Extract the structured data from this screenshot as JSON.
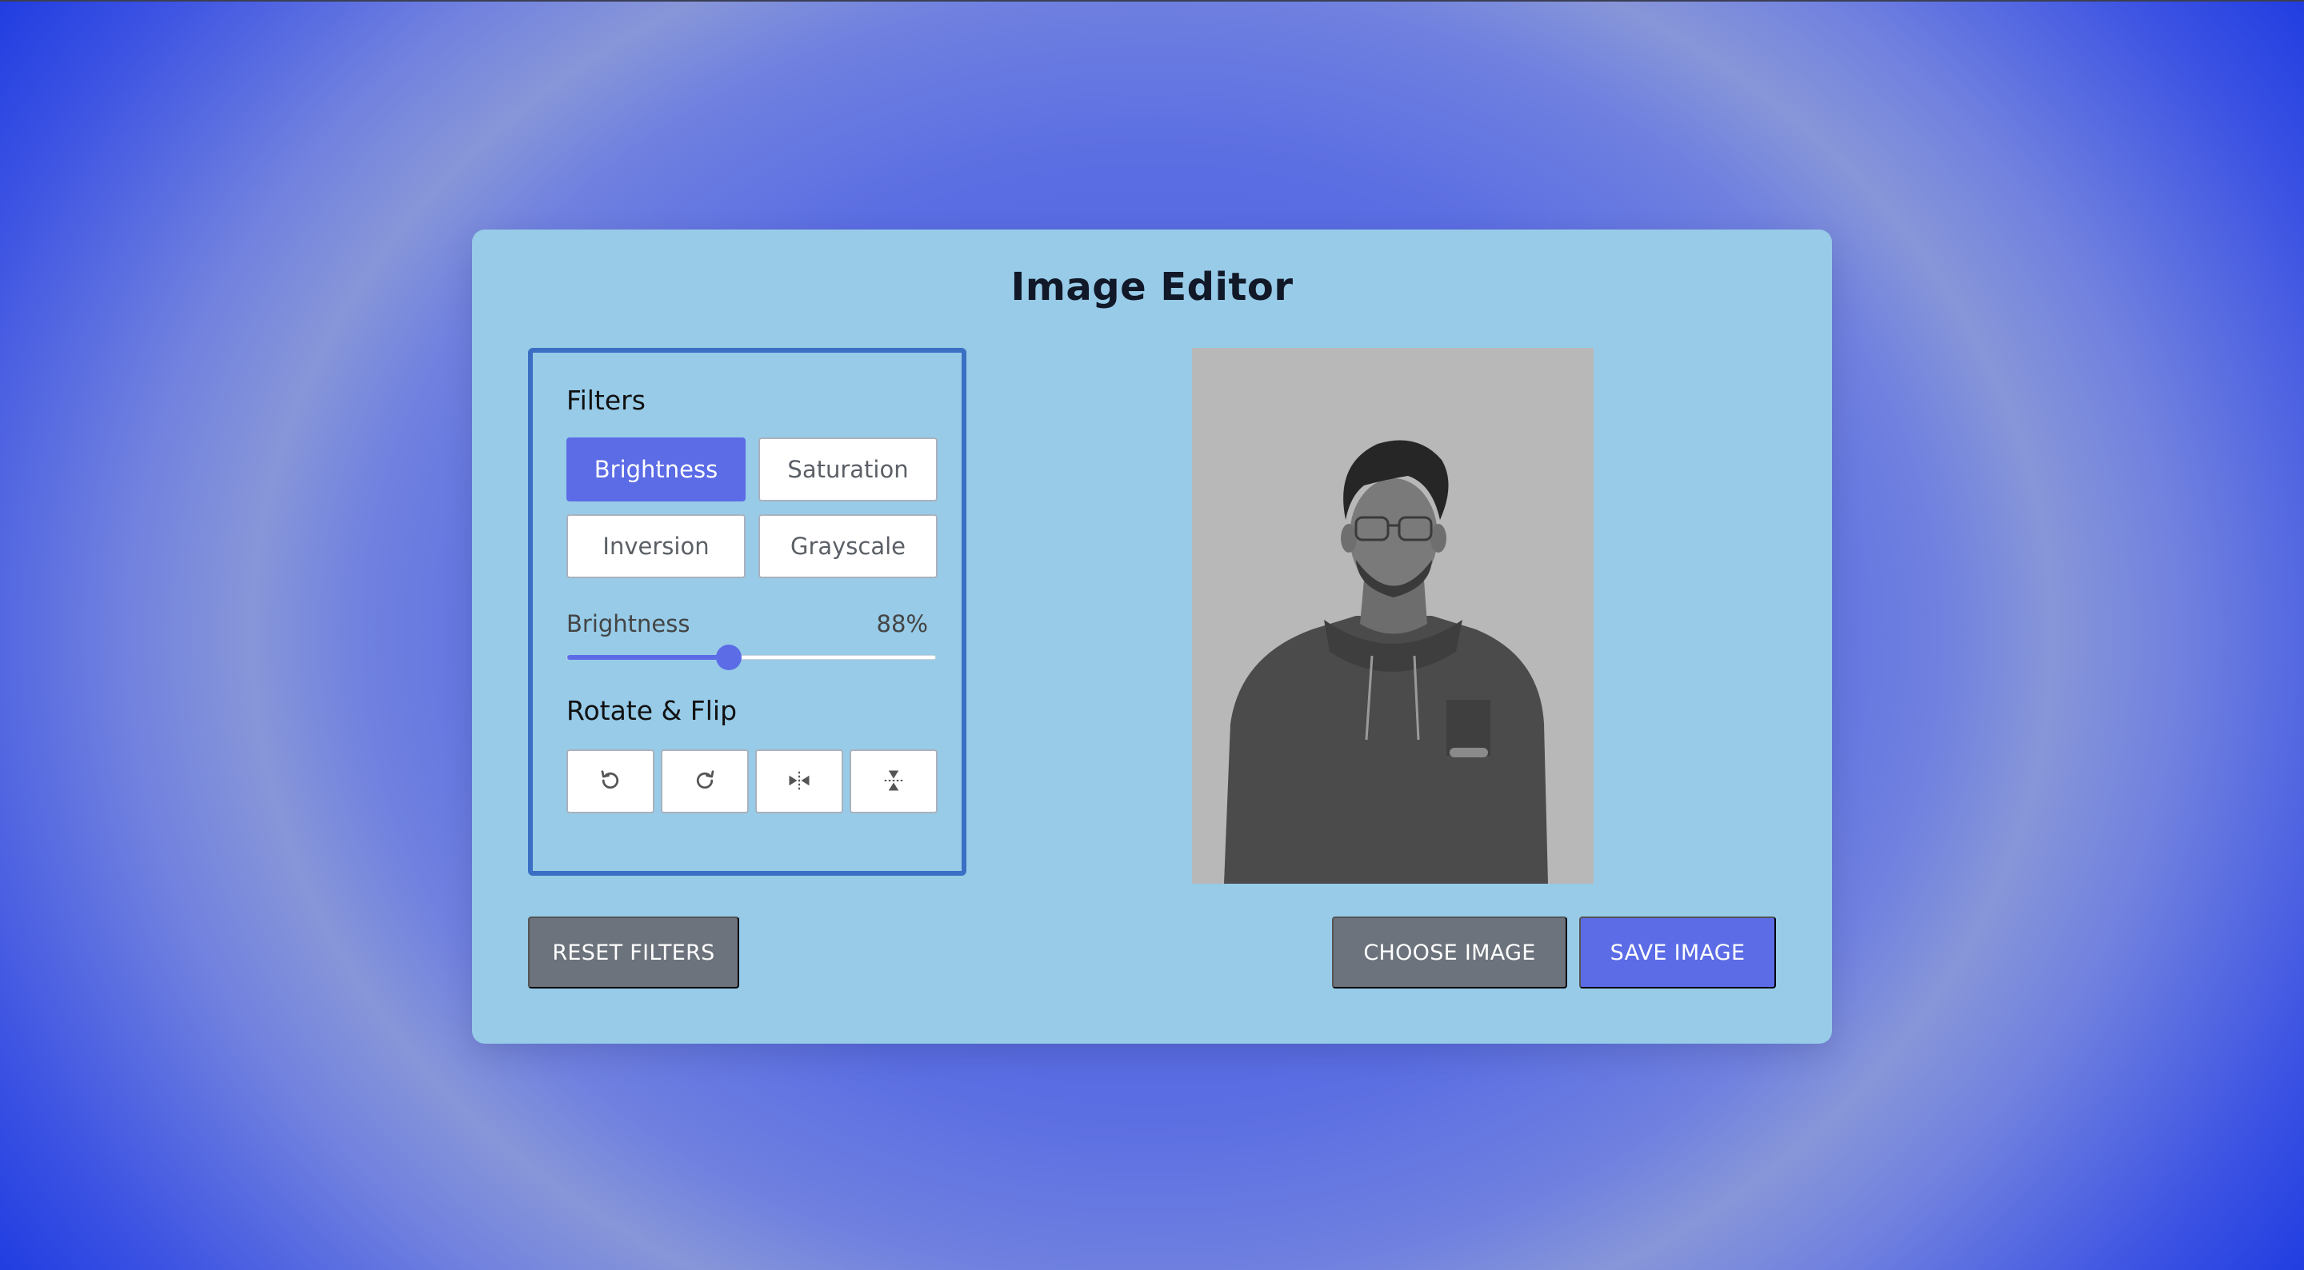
{
  "editor": {
    "title": "Image Editor"
  },
  "filters": {
    "heading": "Filters",
    "options": [
      {
        "label": "Brightness",
        "active": true
      },
      {
        "label": "Saturation",
        "active": false
      },
      {
        "label": "Inversion",
        "active": false
      },
      {
        "label": "Grayscale",
        "active": false
      }
    ]
  },
  "slider": {
    "label": "Brightness",
    "value_text": "88%",
    "fraction": 0.44
  },
  "rotate": {
    "heading": "Rotate & Flip",
    "buttons": [
      {
        "icon": "rotate-left-icon"
      },
      {
        "icon": "rotate-right-icon"
      },
      {
        "icon": "flip-horizontal-icon"
      },
      {
        "icon": "flip-vertical-icon"
      }
    ]
  },
  "actions": {
    "reset": "RESET FILTERS",
    "choose": "CHOOSE IMAGE",
    "save": "SAVE IMAGE"
  },
  "colors": {
    "accent": "#5b6ce6",
    "card": "#97cbe8",
    "panel_border": "#3a6fc4",
    "gray_button": "#6c737c"
  }
}
